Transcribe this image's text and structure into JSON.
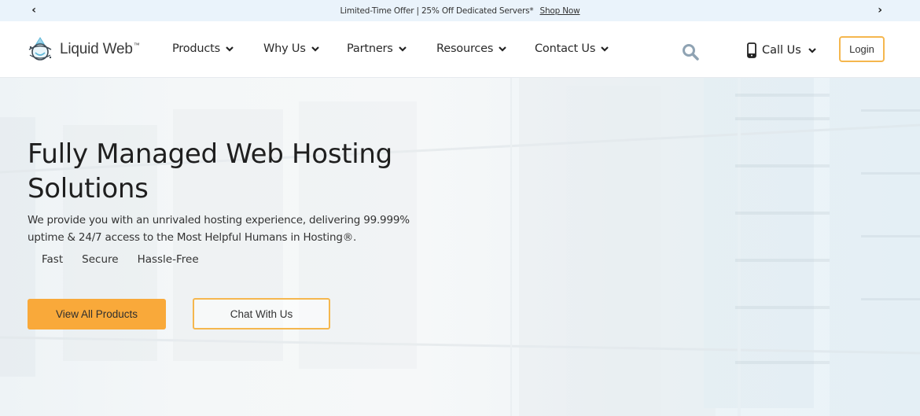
{
  "promo": {
    "prev_icon": "chevron-left-icon",
    "text": "Limited-Time Offer | 25% Off Dedicated Servers*",
    "link_label": "Shop Now",
    "next_icon": "chevron-right-icon"
  },
  "header": {
    "brand": "Liquid Web",
    "trademark": "™",
    "nav": [
      {
        "label": "Products"
      },
      {
        "label": "Why Us"
      },
      {
        "label": "Partners"
      },
      {
        "label": "Resources"
      },
      {
        "label": "Contact Us"
      }
    ],
    "search_icon": "search-icon",
    "call_label": "Call Us",
    "login_label": "Login"
  },
  "hero": {
    "title": "Fully Managed Web Hosting Solutions",
    "subtitle": "We provide you with an unrivaled hosting experience, delivering 99.999% uptime & 24/7 access to the Most Helpful Humans in Hosting®.",
    "features": [
      "Fast",
      "Secure",
      "Hassle-Free"
    ],
    "primary_cta": "View All Products",
    "secondary_cta": "Chat With Us"
  },
  "colors": {
    "accent": "#f9a93a",
    "accent_border": "#f5b74e",
    "promo_bg": "#eaf3fb",
    "search_icon": "#8fa3b3",
    "logo_blue": "#5fb8d8"
  }
}
